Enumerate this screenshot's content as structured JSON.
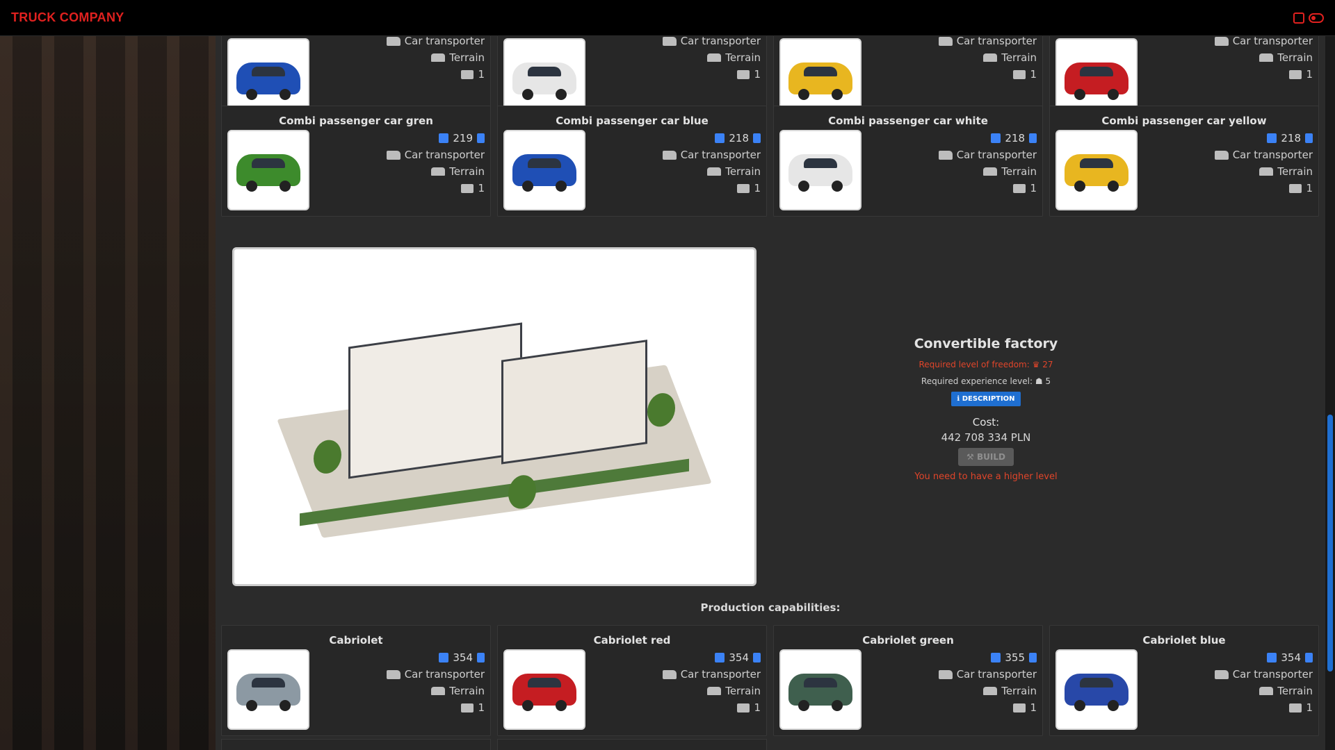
{
  "app": {
    "title": "TRUCK COMPANY"
  },
  "top_section": {
    "cards": [
      {
        "title": "",
        "transport": "Car transporter",
        "terrain": "Terrain",
        "count": "1",
        "color": "#1f4fb5"
      },
      {
        "title": "",
        "transport": "Car transporter",
        "terrain": "Terrain",
        "count": "1",
        "color": "#e6e6e6"
      },
      {
        "title": "",
        "transport": "Car transporter",
        "terrain": "Terrain",
        "count": "1",
        "color": "#e8b620"
      },
      {
        "title": "",
        "transport": "Car transporter",
        "terrain": "Terrain",
        "count": "1",
        "color": "#c51d22"
      }
    ]
  },
  "combi_section": {
    "cards": [
      {
        "title": "Combi passenger car gren",
        "price": "219",
        "transport": "Car transporter",
        "terrain": "Terrain",
        "count": "1",
        "color": "#3d8b2c"
      },
      {
        "title": "Combi passenger car blue",
        "price": "218",
        "transport": "Car transporter",
        "terrain": "Terrain",
        "count": "1",
        "color": "#1f4fb5"
      },
      {
        "title": "Combi passenger car white",
        "price": "218",
        "transport": "Car transporter",
        "terrain": "Terrain",
        "count": "1",
        "color": "#e6e6e6"
      },
      {
        "title": "Combi passenger car yellow",
        "price": "218",
        "transport": "Car transporter",
        "terrain": "Terrain",
        "count": "1",
        "color": "#e8b620"
      }
    ]
  },
  "factory": {
    "name": "Convertible factory",
    "required_freedom": "Required level of freedom:",
    "required_freedom_value": "27",
    "required_experience": "Required experience level:",
    "required_experience_value": "5",
    "description_label": "DESCRIPTION",
    "cost_label": "Cost:",
    "cost_value": "442 708 334  PLN",
    "build_label": "BUILD",
    "warning": "You need to have a higher level",
    "production_label": "Production capabilities:"
  },
  "production": {
    "cards": [
      {
        "title": "Cabriolet",
        "price": "354",
        "transport": "Car transporter",
        "terrain": "Terrain",
        "count": "1",
        "color": "#8c99a3"
      },
      {
        "title": "Cabriolet red",
        "price": "354",
        "transport": "Car transporter",
        "terrain": "Terrain",
        "count": "1",
        "color": "#c51d22"
      },
      {
        "title": "Cabriolet green",
        "price": "355",
        "transport": "Car transporter",
        "terrain": "Terrain",
        "count": "1",
        "color": "#3f5f4e"
      },
      {
        "title": "Cabriolet blue",
        "price": "354",
        "transport": "Car transporter",
        "terrain": "Terrain",
        "count": "1",
        "color": "#2848a8"
      }
    ]
  },
  "colors": {
    "accent": "#1f6fd1",
    "brand": "#e0211f",
    "warning": "#e0452a"
  }
}
